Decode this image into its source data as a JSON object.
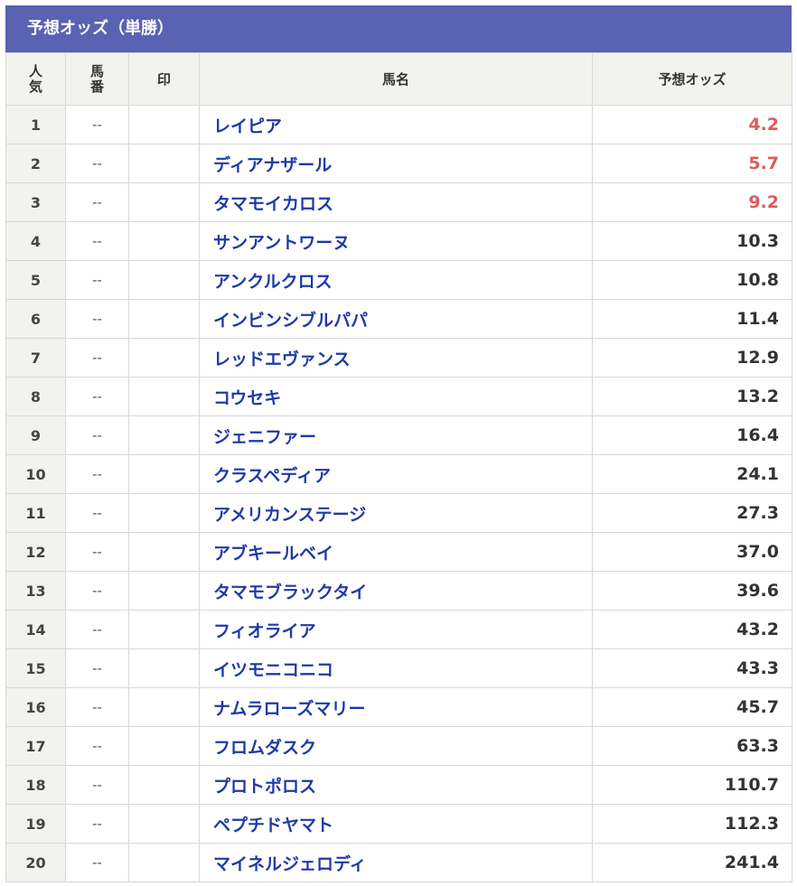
{
  "title": "予想オッズ（単勝）",
  "colors": {
    "header_bg": "#5a62b3",
    "name_text": "#1f3aa6",
    "hot_odds": "#e05a5a"
  },
  "columns": {
    "rank_line1": "人",
    "rank_line2": "気",
    "num_line1": "馬",
    "num_line2": "番",
    "mark": "印",
    "name": "馬名",
    "odds": "予想オッズ"
  },
  "rows": [
    {
      "rank": "1",
      "num": "--",
      "mark": "",
      "name": "レイピア",
      "odds": "4.2",
      "hot": true
    },
    {
      "rank": "2",
      "num": "--",
      "mark": "",
      "name": "ディアナザール",
      "odds": "5.7",
      "hot": true
    },
    {
      "rank": "3",
      "num": "--",
      "mark": "",
      "name": "タマモイカロス",
      "odds": "9.2",
      "hot": true
    },
    {
      "rank": "4",
      "num": "--",
      "mark": "",
      "name": "サンアントワーヌ",
      "odds": "10.3",
      "hot": false
    },
    {
      "rank": "5",
      "num": "--",
      "mark": "",
      "name": "アンクルクロス",
      "odds": "10.8",
      "hot": false
    },
    {
      "rank": "6",
      "num": "--",
      "mark": "",
      "name": "インビンシブルパパ",
      "odds": "11.4",
      "hot": false
    },
    {
      "rank": "7",
      "num": "--",
      "mark": "",
      "name": "レッドエヴァンス",
      "odds": "12.9",
      "hot": false
    },
    {
      "rank": "8",
      "num": "--",
      "mark": "",
      "name": "コウセキ",
      "odds": "13.2",
      "hot": false
    },
    {
      "rank": "9",
      "num": "--",
      "mark": "",
      "name": "ジェニファー",
      "odds": "16.4",
      "hot": false
    },
    {
      "rank": "10",
      "num": "--",
      "mark": "",
      "name": "クラスペディア",
      "odds": "24.1",
      "hot": false
    },
    {
      "rank": "11",
      "num": "--",
      "mark": "",
      "name": "アメリカンステージ",
      "odds": "27.3",
      "hot": false
    },
    {
      "rank": "12",
      "num": "--",
      "mark": "",
      "name": "アブキールベイ",
      "odds": "37.0",
      "hot": false
    },
    {
      "rank": "13",
      "num": "--",
      "mark": "",
      "name": "タマモブラックタイ",
      "odds": "39.6",
      "hot": false
    },
    {
      "rank": "14",
      "num": "--",
      "mark": "",
      "name": "フィオライア",
      "odds": "43.2",
      "hot": false
    },
    {
      "rank": "15",
      "num": "--",
      "mark": "",
      "name": "イツモニコニコ",
      "odds": "43.3",
      "hot": false
    },
    {
      "rank": "16",
      "num": "--",
      "mark": "",
      "name": "ナムラローズマリー",
      "odds": "45.7",
      "hot": false
    },
    {
      "rank": "17",
      "num": "--",
      "mark": "",
      "name": "フロムダスク",
      "odds": "63.3",
      "hot": false
    },
    {
      "rank": "18",
      "num": "--",
      "mark": "",
      "name": "プロトポロス",
      "odds": "110.7",
      "hot": false
    },
    {
      "rank": "19",
      "num": "--",
      "mark": "",
      "name": "ペプチドヤマト",
      "odds": "112.3",
      "hot": false
    },
    {
      "rank": "20",
      "num": "--",
      "mark": "",
      "name": "マイネルジェロディ",
      "odds": "241.4",
      "hot": false
    }
  ]
}
